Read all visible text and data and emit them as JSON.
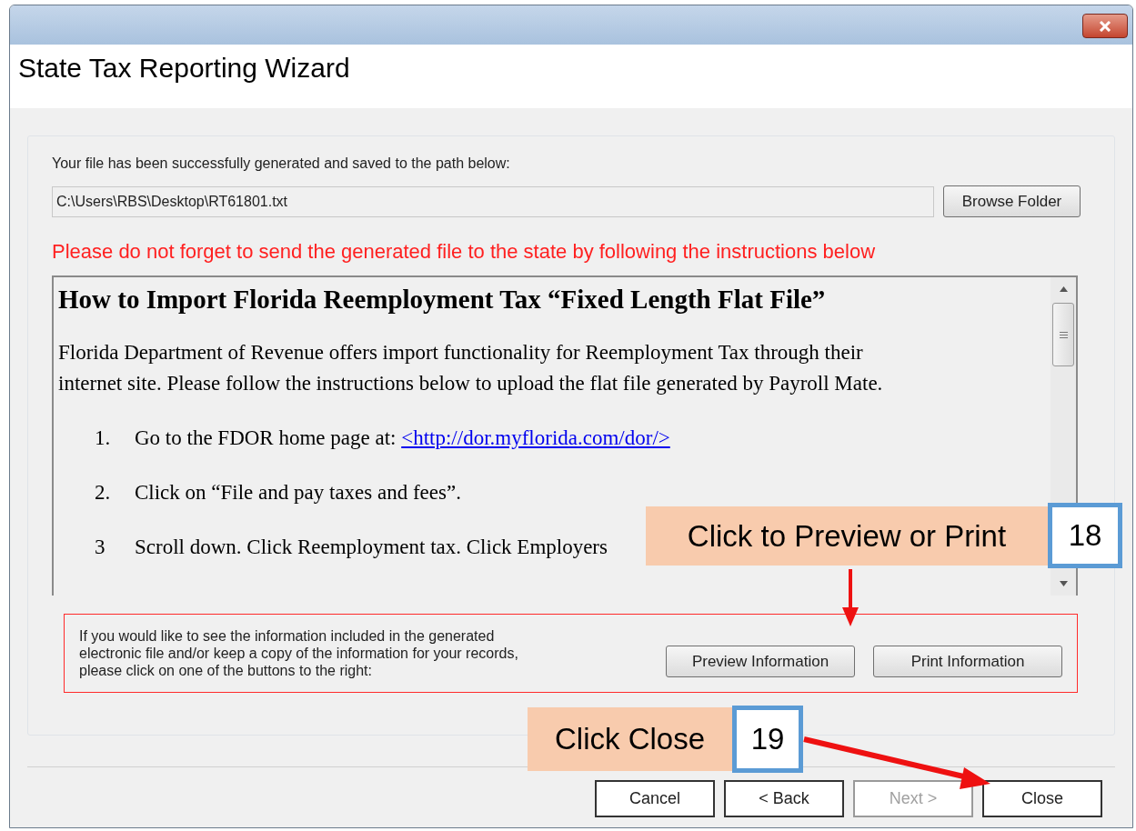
{
  "window": {
    "title": "State Tax Reporting Wizard"
  },
  "message": "Your file has been successfully generated and saved to the path below:",
  "path_field": {
    "value": "C:\\Users\\RBS\\Desktop\\RT61801.txt"
  },
  "browse_button": "Browse Folder",
  "warning": "Please do not forget to send the generated file to the state by following the instructions below",
  "document": {
    "heading": "How to Import Florida Reemployment Tax “Fixed Length Flat File”",
    "intro": "Florida Department of Revenue offers import functionality for Reemployment Tax through their internet site. Please follow the instructions below to upload the flat file generated by Payroll Mate.",
    "steps": [
      {
        "number": "1.",
        "text": "Go to the FDOR home page at: ",
        "link": "<http://dor.myflorida.com/dor/>"
      },
      {
        "number": "2.",
        "text": "Click on “File and pay taxes and fees”."
      },
      {
        "number": "3",
        "text": "Scroll down. Click Reemployment tax. Click Employers"
      }
    ]
  },
  "preview_panel": {
    "text": "If you would like to see the information included in the generated electronic file and/or keep a copy of the information for your records, please click on one of the buttons to the right:",
    "buttons": [
      "Preview Information",
      "Print Information"
    ]
  },
  "footer_buttons": [
    {
      "label": "Cancel",
      "disabled": false
    },
    {
      "label": "< Back",
      "disabled": false
    },
    {
      "label": "Next >",
      "disabled": true
    },
    {
      "label": "Close",
      "disabled": false
    }
  ],
  "callouts": [
    {
      "text": "Click to Preview or Print",
      "number": "18"
    },
    {
      "text": "Click Close",
      "number": "19"
    }
  ]
}
